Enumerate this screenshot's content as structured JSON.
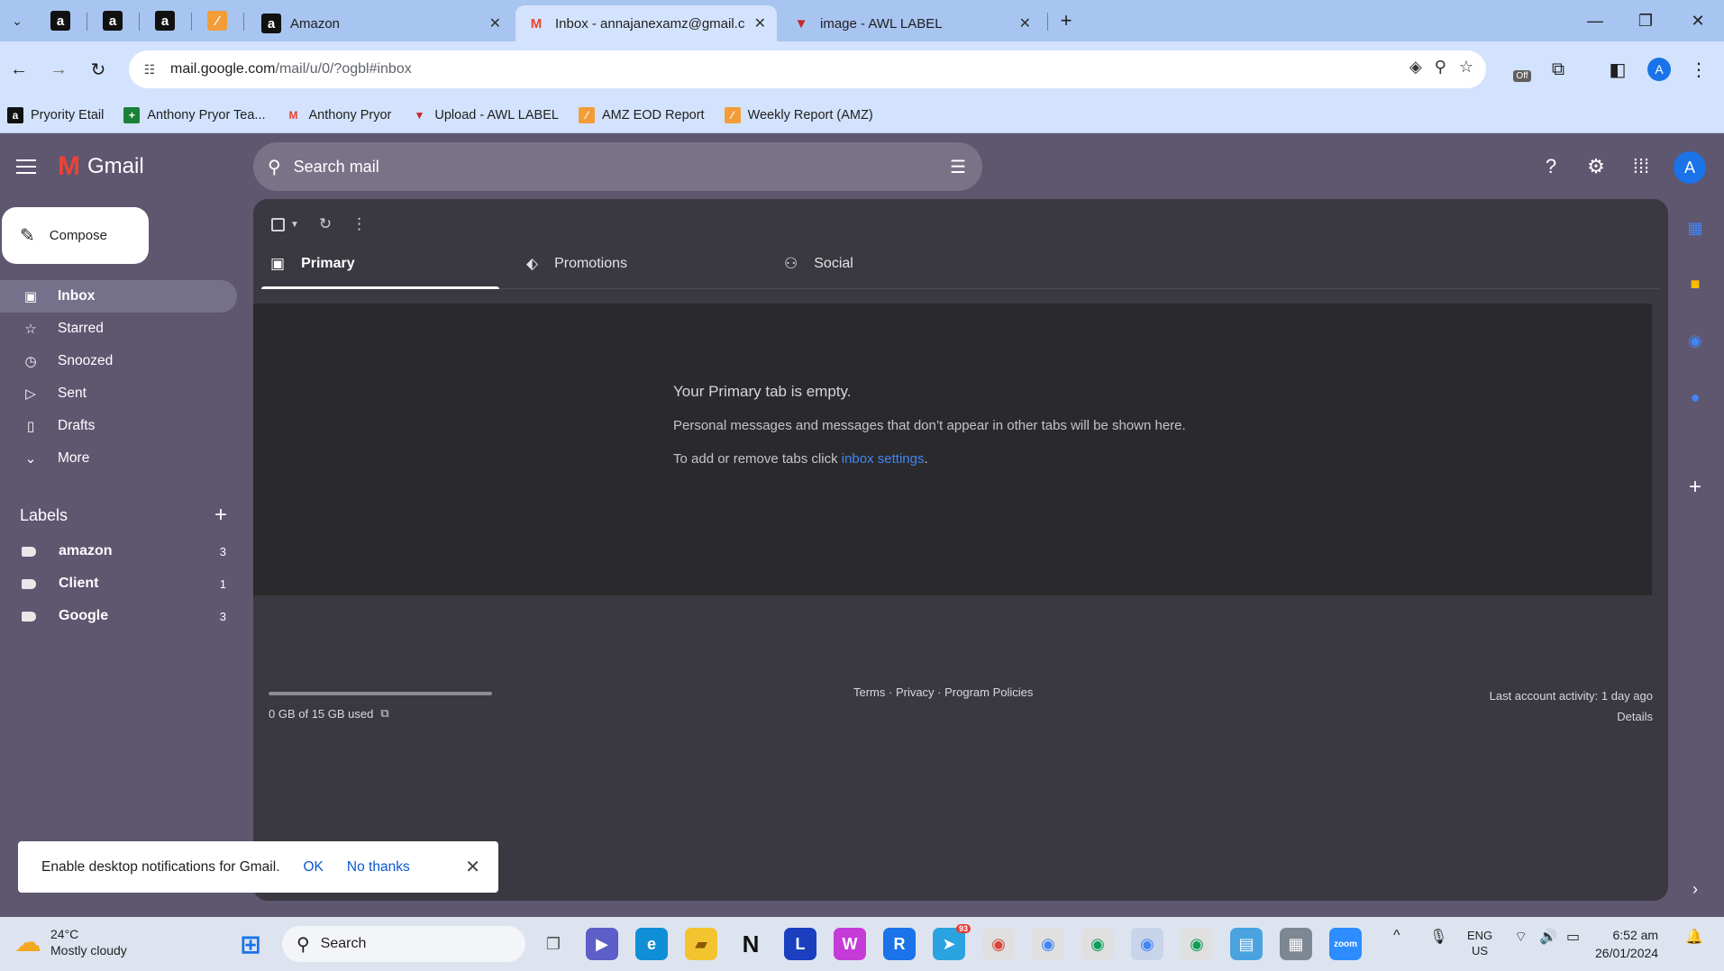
{
  "browser": {
    "tabs": [
      {
        "title": "Amazon",
        "favicon": "amazon-icon"
      },
      {
        "title": "Inbox - annajanexamz@gmail.c",
        "favicon": "gmail-icon"
      },
      {
        "title": "image - AWL LABEL",
        "favicon": "awl-icon"
      }
    ],
    "url_host": "mail.google.com",
    "url_path": "/mail/u/0/?ogbl#inbox",
    "extension_badge": "Off",
    "profile_initial": "A"
  },
  "bookmarks": [
    {
      "label": "Pryority Etail",
      "icon": "amazon-icon"
    },
    {
      "label": "Anthony Pryor Tea...",
      "icon": "plus-doc-icon"
    },
    {
      "label": "Anthony Pryor",
      "icon": "gmail-icon"
    },
    {
      "label": "Upload - AWL LABEL",
      "icon": "awl-icon"
    },
    {
      "label": "AMZ EOD Report",
      "icon": "report-icon"
    },
    {
      "label": "Weekly Report (AMZ)",
      "icon": "report-icon"
    }
  ],
  "gmail": {
    "logo_text": "Gmail",
    "search_placeholder": "Search mail",
    "compose_label": "Compose",
    "account_initial": "A",
    "nav": [
      {
        "label": "Inbox",
        "icon": "inbox-icon",
        "active": true
      },
      {
        "label": "Starred",
        "icon": "star-icon"
      },
      {
        "label": "Snoozed",
        "icon": "clock-icon"
      },
      {
        "label": "Sent",
        "icon": "send-icon"
      },
      {
        "label": "Drafts",
        "icon": "draft-icon"
      },
      {
        "label": "More",
        "icon": "chevron-down-icon"
      }
    ],
    "labels_title": "Labels",
    "labels": [
      {
        "name": "amazon",
        "count": "3"
      },
      {
        "name": "Client",
        "count": "1"
      },
      {
        "name": "Google",
        "count": "3"
      }
    ],
    "tabs": [
      {
        "label": "Primary",
        "icon": "inbox-tab-icon",
        "active": true
      },
      {
        "label": "Promotions",
        "icon": "tag-icon"
      },
      {
        "label": "Social",
        "icon": "people-icon"
      }
    ],
    "empty": {
      "title": "Your Primary tab is empty.",
      "body": "Personal messages and messages that don’t appear in other tabs will be shown here.",
      "foot_prefix": "To add or remove tabs click ",
      "foot_link": "inbox settings",
      "foot_suffix": "."
    },
    "storage": {
      "text": "0 GB of 15 GB used",
      "fraction_used": 0.0
    },
    "footer_links": "Terms · Privacy · Program Policies",
    "activity": "Last account activity: 1 day ago",
    "details": "Details",
    "notification": {
      "message": "Enable desktop notifications for Gmail.",
      "ok": "OK",
      "no_thanks": "No thanks"
    }
  },
  "taskbar": {
    "temperature": "24°C",
    "weather": "Mostly cloudy",
    "search": "Search",
    "telegram_badge": "93",
    "lang_line1": "ENG",
    "lang_line2": "US",
    "time": "6:52 am",
    "date": "26/01/2024"
  },
  "colors": {
    "gmail_bg": "#5f5670",
    "panel": "#3a3840",
    "empty_panel": "#2a2a2c",
    "link": "#4285f4",
    "chrome_accent": "#d3e3fd"
  }
}
